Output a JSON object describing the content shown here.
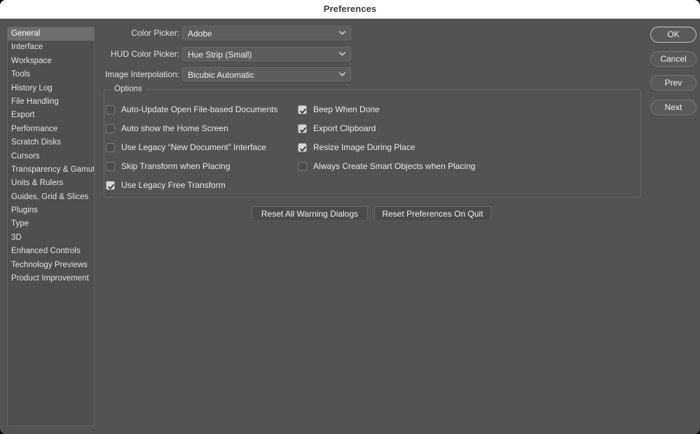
{
  "window": {
    "title": "Preferences"
  },
  "sidebar": {
    "items": [
      {
        "label": "General",
        "selected": true
      },
      {
        "label": "Interface",
        "selected": false
      },
      {
        "label": "Workspace",
        "selected": false
      },
      {
        "label": "Tools",
        "selected": false
      },
      {
        "label": "History Log",
        "selected": false
      },
      {
        "label": "File Handling",
        "selected": false
      },
      {
        "label": "Export",
        "selected": false
      },
      {
        "label": "Performance",
        "selected": false
      },
      {
        "label": "Scratch Disks",
        "selected": false
      },
      {
        "label": "Cursors",
        "selected": false
      },
      {
        "label": "Transparency & Gamut",
        "selected": false
      },
      {
        "label": "Units & Rulers",
        "selected": false
      },
      {
        "label": "Guides, Grid & Slices",
        "selected": false
      },
      {
        "label": "Plugins",
        "selected": false
      },
      {
        "label": "Type",
        "selected": false
      },
      {
        "label": "3D",
        "selected": false
      },
      {
        "label": "Enhanced Controls",
        "selected": false
      },
      {
        "label": "Technology Previews",
        "selected": false
      },
      {
        "label": "Product Improvement",
        "selected": false
      }
    ]
  },
  "form": {
    "rows": [
      {
        "label": "Color Picker:",
        "value": "Adobe",
        "icon": "chevron-down-icon"
      },
      {
        "label": "HUD Color Picker:",
        "value": "Hue Strip (Small)",
        "icon": "chevron-down-icon"
      },
      {
        "label": "Image Interpolation:",
        "value": "Bicubic Automatic",
        "icon": "chevron-down-icon"
      }
    ]
  },
  "options": {
    "group_label": "Options",
    "left_column": [
      {
        "label": "Auto-Update Open File-based Documents",
        "checked": false
      },
      {
        "label": "Auto show the Home Screen",
        "checked": false
      },
      {
        "label": "Use Legacy “New Document” Interface",
        "checked": false
      },
      {
        "label": "Skip Transform when Placing",
        "checked": false
      },
      {
        "label": "Use Legacy Free Transform",
        "checked": true
      }
    ],
    "right_column": [
      {
        "label": "Beep When Done",
        "checked": true
      },
      {
        "label": "Export Clipboard",
        "checked": true
      },
      {
        "label": "Resize Image During Place",
        "checked": true
      },
      {
        "label": "Always Create Smart Objects when Placing",
        "checked": false
      }
    ]
  },
  "reset_buttons": [
    {
      "label": "Reset All Warning Dialogs"
    },
    {
      "label": "Reset Preferences On Quit"
    }
  ],
  "actions": [
    {
      "label": "OK",
      "default": true
    },
    {
      "label": "Cancel",
      "default": false
    },
    {
      "label": "Prev",
      "default": false
    },
    {
      "label": "Next",
      "default": false
    }
  ],
  "colors": {
    "dialog_bg": "#535353",
    "titlebar_bg": "#ffffff",
    "sidebar_bg": "#4f4f4f",
    "selection": "#6e6e6e",
    "text": "#eaeaea"
  }
}
